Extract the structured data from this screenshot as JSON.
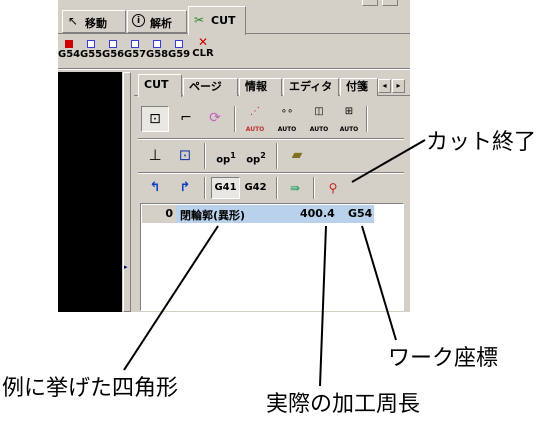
{
  "tabs": {
    "items": [
      {
        "label": "移動",
        "icon": "cursor-icon"
      },
      {
        "label": "解析",
        "icon": "info-icon"
      },
      {
        "label": "CUT",
        "icon": "scissors-icon"
      }
    ],
    "active": "CUT"
  },
  "gcodes": {
    "items": [
      "G54",
      "G55",
      "G56",
      "G57",
      "G58",
      "G59"
    ],
    "clear_label": "CLR",
    "active": "G54"
  },
  "subtabs": {
    "items": [
      "CUT",
      "ページ",
      "情報",
      "エディタ",
      "付箋"
    ],
    "active": "CUT"
  },
  "toolbar1": {
    "auto_label": "AUTO"
  },
  "toolbar2": {
    "op1_label": "op",
    "op1_sup": "1",
    "op2_label": "op",
    "op2_sup": "2"
  },
  "toolbar3": {
    "g41_label": "G41",
    "g42_label": "G42"
  },
  "list": {
    "rows": [
      {
        "index": "0",
        "name": "閉輪郭(異形)",
        "length": "400.4",
        "work": "G54"
      }
    ]
  },
  "annotations": {
    "cut_end": "カット終了",
    "example_shape": "例に挙げた四角形",
    "work_coord": "ワーク座標",
    "actual_length": "実際の加工周長"
  },
  "colors": {
    "panel": "#d4d0c8",
    "selected_row": "#b9d1ea",
    "active_gcode": "#cc0000",
    "gcode_box": "#3b3bd0",
    "clear_x": "#cc0000",
    "left_pane": "#000000"
  }
}
